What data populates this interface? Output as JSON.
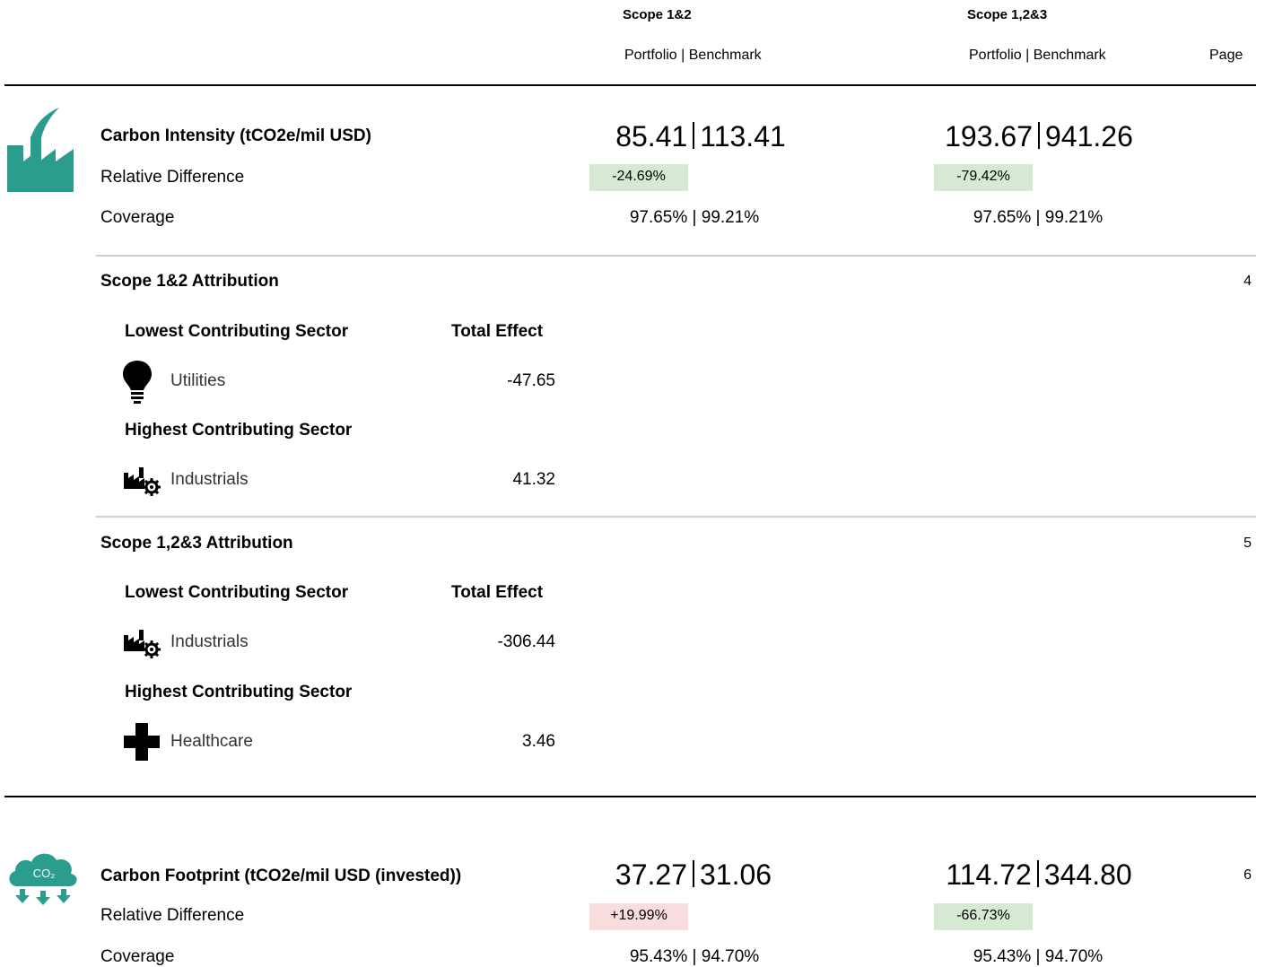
{
  "header": {
    "scope12_label": "Scope 1&2",
    "scope123_label": "Scope 1,2&3",
    "sub_label_12": "Portfolio | Benchmark",
    "sub_label_123": "Portfolio | Benchmark",
    "page_label": "Page"
  },
  "carbon_intensity": {
    "title": "Carbon Intensity (tCO2e/mil USD)",
    "icon": "factory-icon",
    "icon_color": "#2a9d8f",
    "scope12": {
      "portfolio": "85.41",
      "benchmark": "113.41",
      "relative_diff": "-24.69%",
      "coverage": "97.65% | 99.21%"
    },
    "scope123": {
      "portfolio": "193.67",
      "benchmark": "941.26",
      "relative_diff": "-79.42%",
      "coverage": "97.65% | 99.21%"
    },
    "rel_label": "Relative Difference",
    "cov_label": "Coverage"
  },
  "attribution_12": {
    "title": "Scope 1&2 Attribution",
    "page": "4",
    "lowest_label": "Lowest Contributing Sector",
    "effect_label": "Total Effect",
    "highest_label": "Highest Contributing Sector",
    "lowest": {
      "sector": "Utilities",
      "icon": "lightbulb-icon",
      "effect": "-47.65"
    },
    "highest": {
      "sector": "Industrials",
      "icon": "industrials-icon",
      "effect": "41.32"
    }
  },
  "attribution_123": {
    "title": "Scope 1,2&3 Attribution",
    "page": "5",
    "lowest_label": "Lowest Contributing Sector",
    "effect_label": "Total Effect",
    "highest_label": "Highest Contributing Sector",
    "lowest": {
      "sector": "Industrials",
      "icon": "industrials-icon",
      "effect": "-306.44"
    },
    "highest": {
      "sector": "Healthcare",
      "icon": "healthcare-cross-icon",
      "effect": "3.46"
    }
  },
  "carbon_footprint": {
    "title": "Carbon Footprint (tCO2e/mil USD (invested))",
    "page": "6",
    "icon": "co2-cloud-icon",
    "icon_text": "CO₂",
    "icon_color": "#2a9d8f",
    "scope12": {
      "portfolio": "37.27",
      "benchmark": "31.06",
      "relative_diff": "+19.99%",
      "coverage": "95.43% | 94.70%"
    },
    "scope123": {
      "portfolio": "114.72",
      "benchmark": "344.80",
      "relative_diff": "-66.73%",
      "coverage": "95.43% | 94.70%"
    },
    "rel_label": "Relative Difference",
    "cov_label": "Coverage"
  }
}
